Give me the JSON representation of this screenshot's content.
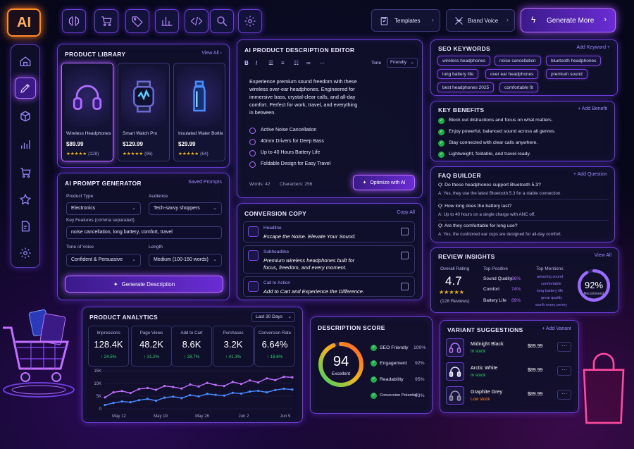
{
  "brand": {
    "logo": "AI"
  },
  "toolbar": {
    "icons": [
      "brain-icon",
      "cart-icon",
      "tag-icon",
      "bar-chart-icon",
      "code-icon",
      "search-icon",
      "gear-icon"
    ]
  },
  "header": {
    "templates": "Templates",
    "brand_voice": "Brand Voice",
    "generate_more": "Generate More"
  },
  "sidebar": {
    "items": [
      "home-icon",
      "edit-icon",
      "cube-icon",
      "analytics-icon",
      "cart-icon",
      "star-icon",
      "document-icon",
      "settings-icon"
    ],
    "active": 1
  },
  "library": {
    "title": "PRODUCT LIBRARY",
    "view_all": "View All",
    "products": [
      {
        "name": "Wireless Headphones",
        "price": "$89.99",
        "stars": "★★★★★",
        "reviews": "(128)"
      },
      {
        "name": "Smart Watch Pro",
        "price": "$129.99",
        "stars": "★★★★★",
        "reviews": "(96)"
      },
      {
        "name": "Insulated Water Bottle",
        "price": "$29.99",
        "stars": "★★★★★",
        "reviews": "(64)"
      }
    ]
  },
  "editor": {
    "title": "AI PRODUCT DESCRIPTION EDITOR",
    "tone_label": "Tone",
    "tone": "Friendly",
    "text": [
      "Experience premium sound freedom with these",
      "wireless over-ear headphones. Engineered for",
      "immersive bass, crystal-clear calls, and all-day",
      "comfort. Perfect for work, travel, and everything",
      "in between."
    ],
    "bullets": [
      "Active Noise Cancellation",
      "40mm Drivers for Deep Bass",
      "Up to 40 Hours Battery Life",
      "Foldable Design for Easy Travel"
    ],
    "words": "Words: 42",
    "characters": "Characters: 256",
    "optimize": "Optimize with AI"
  },
  "seo": {
    "title": "SEO KEYWORDS",
    "add": "Add Keyword +",
    "keywords": [
      "wireless headphones",
      "noise cancellation",
      "bluetooth headphones",
      "long battery life",
      "over ear headphones",
      "premium sound",
      "best headphones 2025",
      "comfortable fit"
    ]
  },
  "benefits": {
    "title": "KEY BENEFITS",
    "add": "+ Add Benefit",
    "items": [
      "Block out distractions and focus on what matters.",
      "Enjoy powerful, balanced sound across all genres.",
      "Stay connected with clear calls anywhere.",
      "Lightweight, foldable, and travel-ready."
    ]
  },
  "faq": {
    "title": "FAQ BUILDER",
    "add": "+ Add Question",
    "items": [
      {
        "q": "Q:  Do these headphones support Bluetooth 5.3?",
        "a": "A:  Yes, they use the latest Bluetooth 5.3 for a stable connection."
      },
      {
        "q": "Q:  How long does the battery last?",
        "a": "A:  Up to 40 hours on a single charge with ANC off."
      },
      {
        "q": "Q:  Are they comfortable for long use?",
        "a": "A:  Yes, the cushioned ear cups are designed for all-day comfort."
      }
    ]
  },
  "prompt": {
    "title": "AI PROMPT GENERATOR",
    "saved": "Saved Prompts",
    "type_label": "Product Type",
    "type": "Electronics",
    "audience_label": "Audience",
    "audience": "Tech-savvy shoppers",
    "features_label": "Key Features (comma separated)",
    "features": "noise cancellation, long battery, comfort, travel",
    "tone_label": "Tone of Voice",
    "tone": "Confident & Persuasive",
    "length_label": "Length",
    "length": "Medium (100-150 words)",
    "button": "Generate Description"
  },
  "copy": {
    "title": "CONVERSION COPY",
    "copy_all": "Copy All",
    "items": [
      {
        "k": "Headline",
        "v": [
          "Escape the Noise. Elevate Your Sound."
        ]
      },
      {
        "k": "Subheadline",
        "v": [
          "Premium wireless headphones built for",
          "focus, freedom, and every moment."
        ]
      },
      {
        "k": "Call to Action",
        "v": [
          "Add to Cart and Experience the Difference."
        ]
      }
    ]
  },
  "review": {
    "title": "REVIEW INSIGHTS",
    "view_all": "View All",
    "overall_label": "Overall Rating",
    "overall": "4.7",
    "stars": "★★★★★",
    "count": "(128 Reviews)",
    "positive_label": "Top Positive",
    "positive": [
      {
        "k": "Sound Quality",
        "v": "86%"
      },
      {
        "k": "Comfort",
        "v": "74%"
      },
      {
        "k": "Battery Life",
        "v": "69%"
      }
    ],
    "mentions_label": "Top Mentions",
    "mentions": [
      "amazing sound",
      "comfortable",
      "long battery life",
      "great quality",
      "worth every penny"
    ],
    "recommend": "92%",
    "recommend_label": "Recommend",
    "recommend_value": 0.92
  },
  "analytics": {
    "title": "PRODUCT ANALYTICS",
    "range": "Last 30 Days",
    "metrics": [
      {
        "k": "Impressions",
        "v": "128.4K",
        "d": "↑ 24.5%"
      },
      {
        "k": "Page Views",
        "v": "48.2K",
        "d": "↑ 31.2%"
      },
      {
        "k": "Add to Cart",
        "v": "8.6K",
        "d": "↑ 28.7%"
      },
      {
        "k": "Purchases",
        "v": "3.2K",
        "d": "↑ 41.3%"
      },
      {
        "k": "Conversion Rate",
        "v": "6.64%",
        "d": "↑ 18.6%"
      }
    ]
  },
  "chart_data": {
    "type": "line",
    "categories": [
      "May 12",
      "May 19",
      "May 26",
      "Jun 2",
      "Jun 9"
    ],
    "yticks": [
      "15K",
      "10K",
      "5K",
      "0"
    ],
    "ylim": [
      0,
      15000
    ],
    "series": [
      {
        "values": [
          4500,
          6500,
          7000,
          6200,
          7800,
          8200,
          7500,
          9000,
          8600,
          8000,
          9600,
          8800,
          10200,
          9400,
          9000,
          10600,
          9800,
          11200,
          10400,
          12000,
          11300,
          12600,
          12400
        ]
      },
      {
        "values": [
          1500,
          2300,
          2900,
          2600,
          3400,
          3900,
          3200,
          4400,
          4800,
          4200,
          5400,
          4900,
          5900,
          5500,
          5200,
          6300,
          6000,
          6800,
          7100,
          6500,
          7400,
          7900,
          7600
        ]
      }
    ]
  },
  "score": {
    "title": "DESCRIPTION SCORE",
    "value": "94",
    "label": "Excellent",
    "fraction": 0.94,
    "items": [
      {
        "k": "SEO Friendly",
        "v": "100%"
      },
      {
        "k": "Engagement",
        "v": "92%"
      },
      {
        "k": "Readability",
        "v": "95%"
      },
      {
        "k": "Conversion Potential",
        "v": "93%"
      }
    ]
  },
  "variants": {
    "title": "VARIANT SUGGESTIONS",
    "add": "+ Add Variant",
    "items": [
      {
        "name": "Midnight Black",
        "stock": "In stock",
        "price": "$89.99",
        "color": "#31d46a"
      },
      {
        "name": "Arctic White",
        "stock": "In stock",
        "price": "$89.99",
        "color": "#31d46a"
      },
      {
        "name": "Graphite Grey",
        "stock": "Low stock",
        "price": "$89.99",
        "color": "#ff8a2a"
      }
    ]
  },
  "colors": {
    "accent": "#8a4bff",
    "green": "#31d46a",
    "orange": "#ff8a2a",
    "star": "#f2b620"
  }
}
